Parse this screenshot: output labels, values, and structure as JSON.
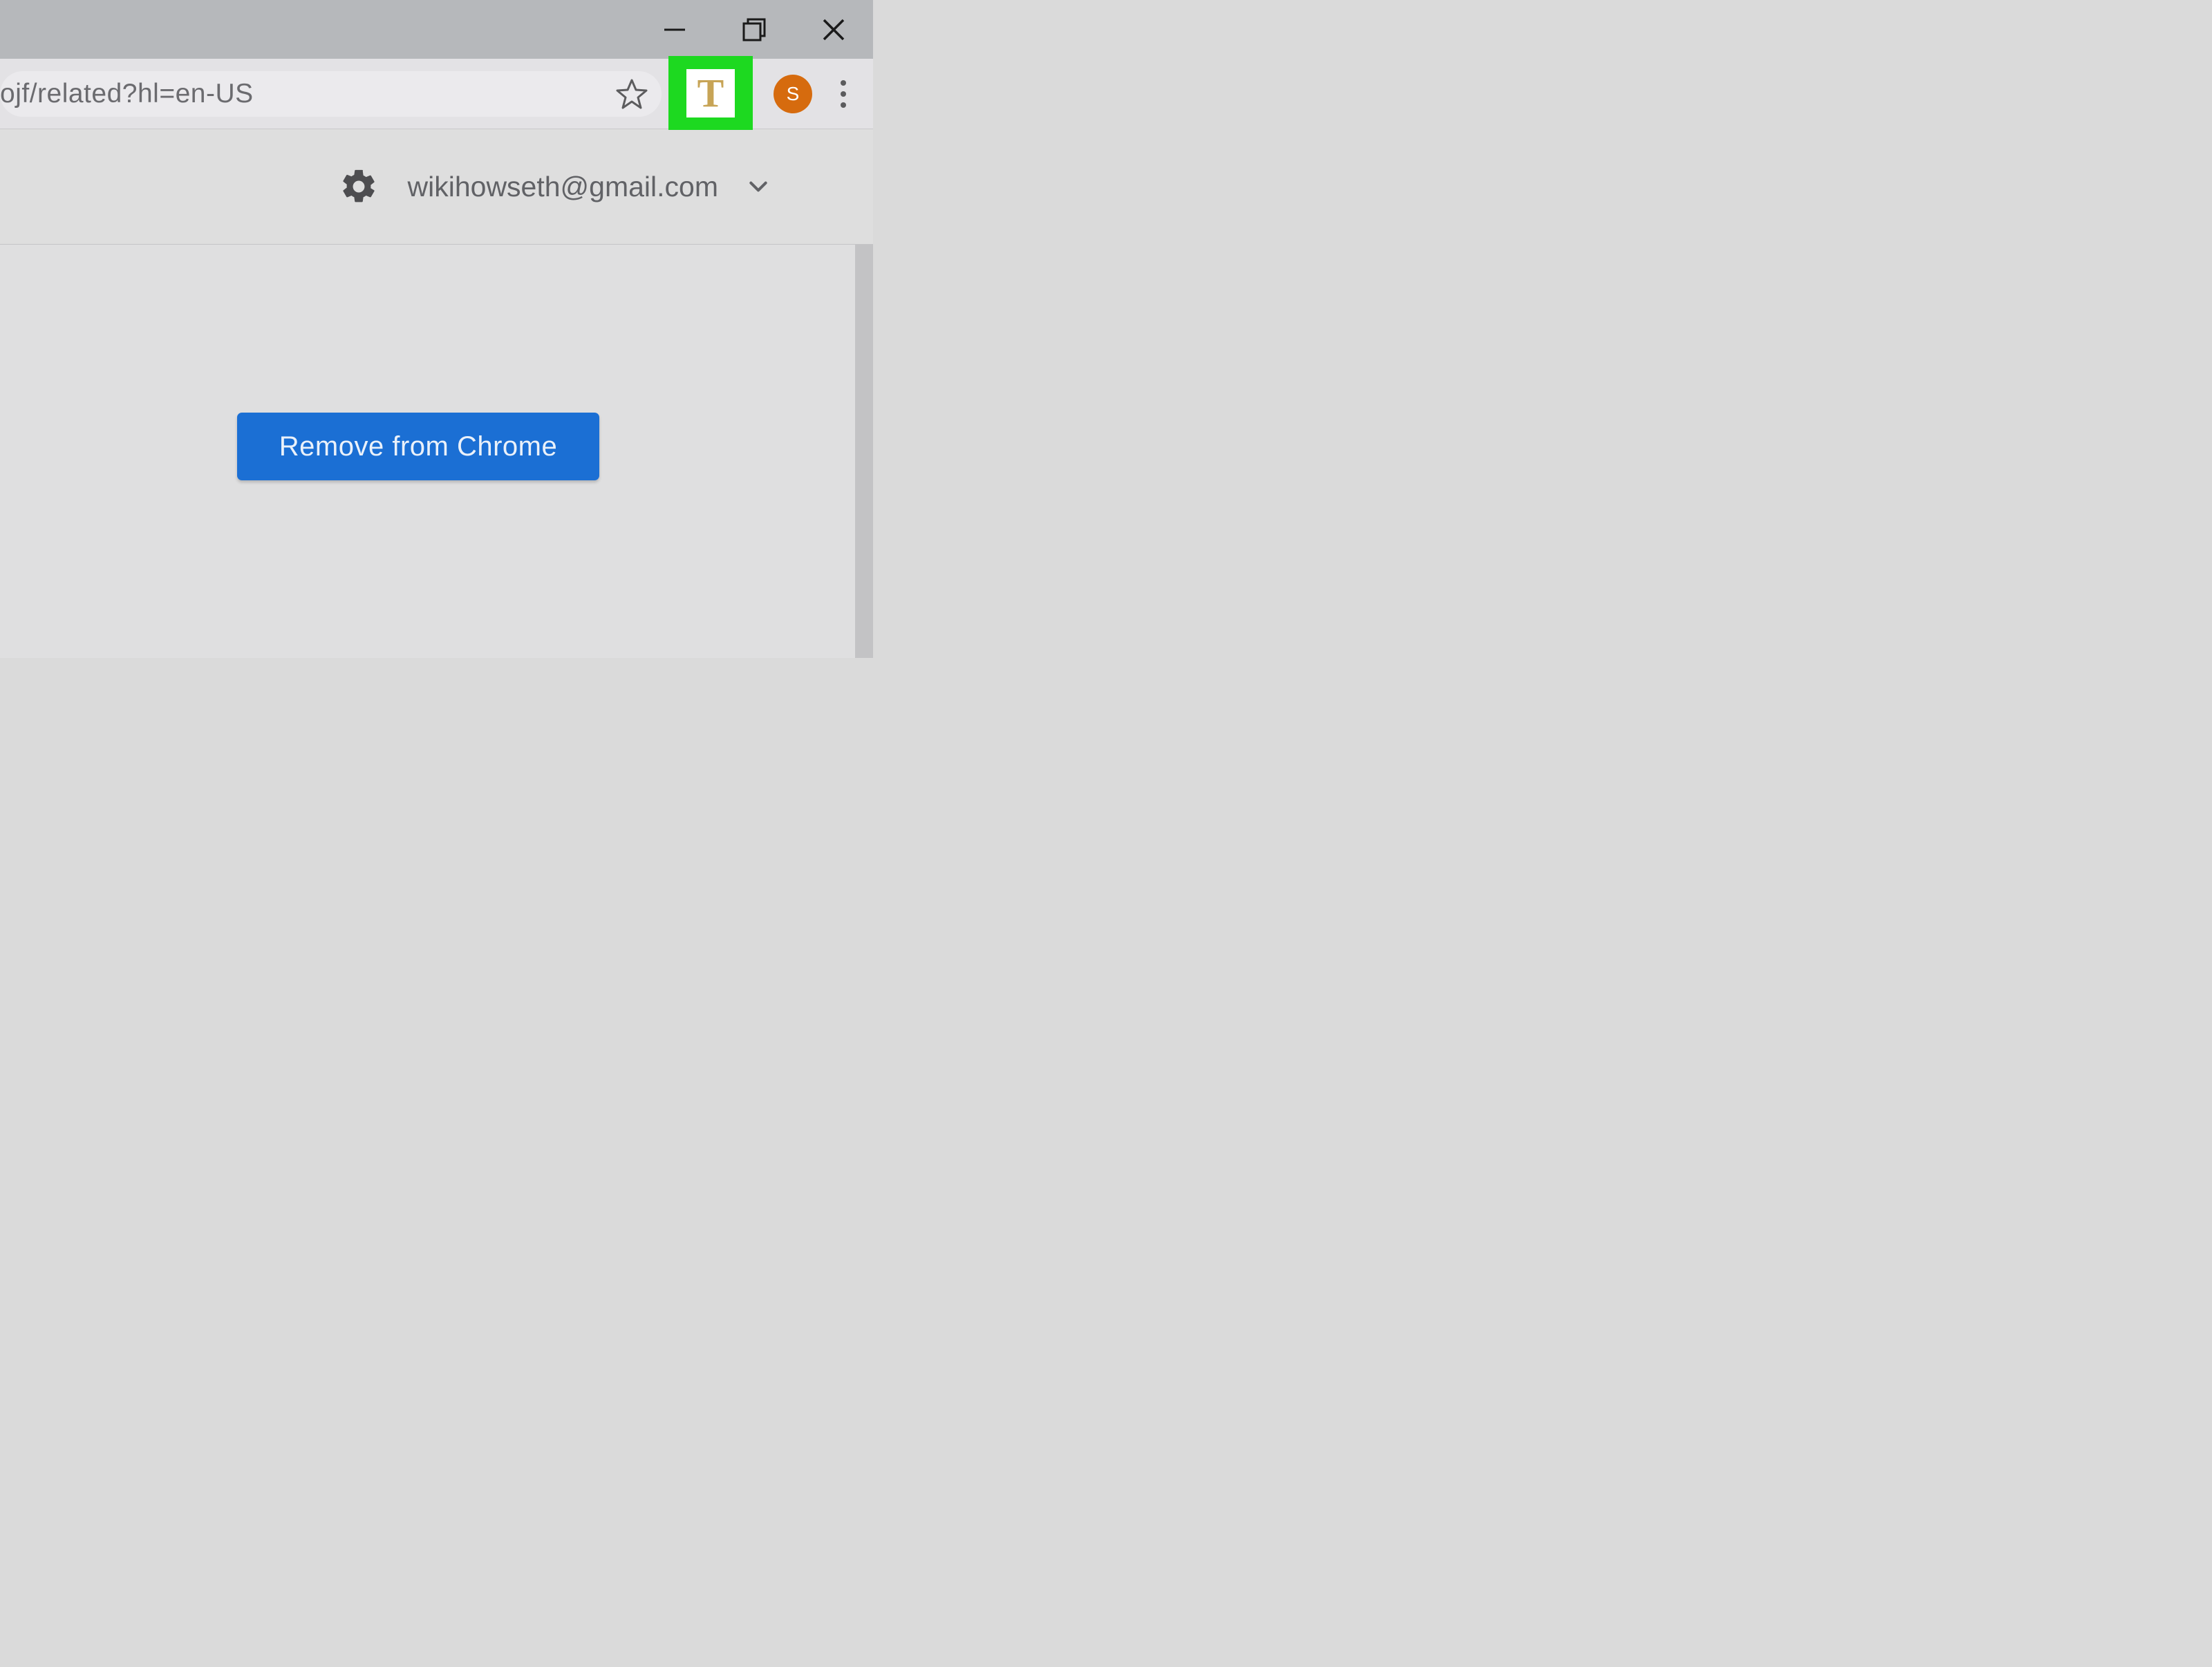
{
  "address_bar": {
    "url_fragment": "ojf/related?hl=en-US"
  },
  "toolbar": {
    "extension_letter": "T",
    "profile_initial": "S"
  },
  "subheader": {
    "email": "wikihowseth@gmail.com"
  },
  "content": {
    "remove_button_label": "Remove from Chrome"
  },
  "colors": {
    "highlight": "#1dd920",
    "primary_button": "#1b6fd4",
    "profile_badge": "#d66b0e"
  }
}
